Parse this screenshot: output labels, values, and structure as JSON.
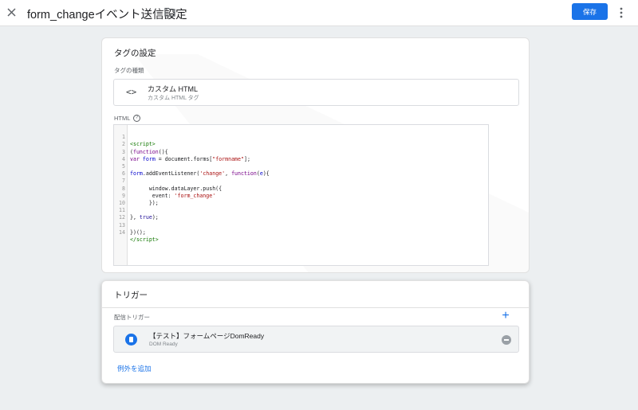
{
  "header": {
    "title": "form_changeイベント送信設定",
    "save_label": "保存"
  },
  "tag_card": {
    "title": "タグの設定",
    "type_label": "タグの種類",
    "type_icon": "<>",
    "type_name": "カスタム HTML",
    "type_sub": "カスタム HTML タグ",
    "html_label": "HTML",
    "help_icon": "?"
  },
  "code": {
    "line_numbers": [
      "1",
      "2",
      "3",
      "4",
      "5",
      "6",
      "7",
      "8",
      "9",
      "10",
      "11",
      "12",
      "13",
      "14"
    ]
  },
  "trigger_card": {
    "title": "トリガー",
    "firing_label": "配信トリガー",
    "add_icon": "+",
    "trigger_name": "【テスト】フォームページDomReady",
    "trigger_type": "DOM Ready",
    "add_exception": "例外を追加"
  }
}
